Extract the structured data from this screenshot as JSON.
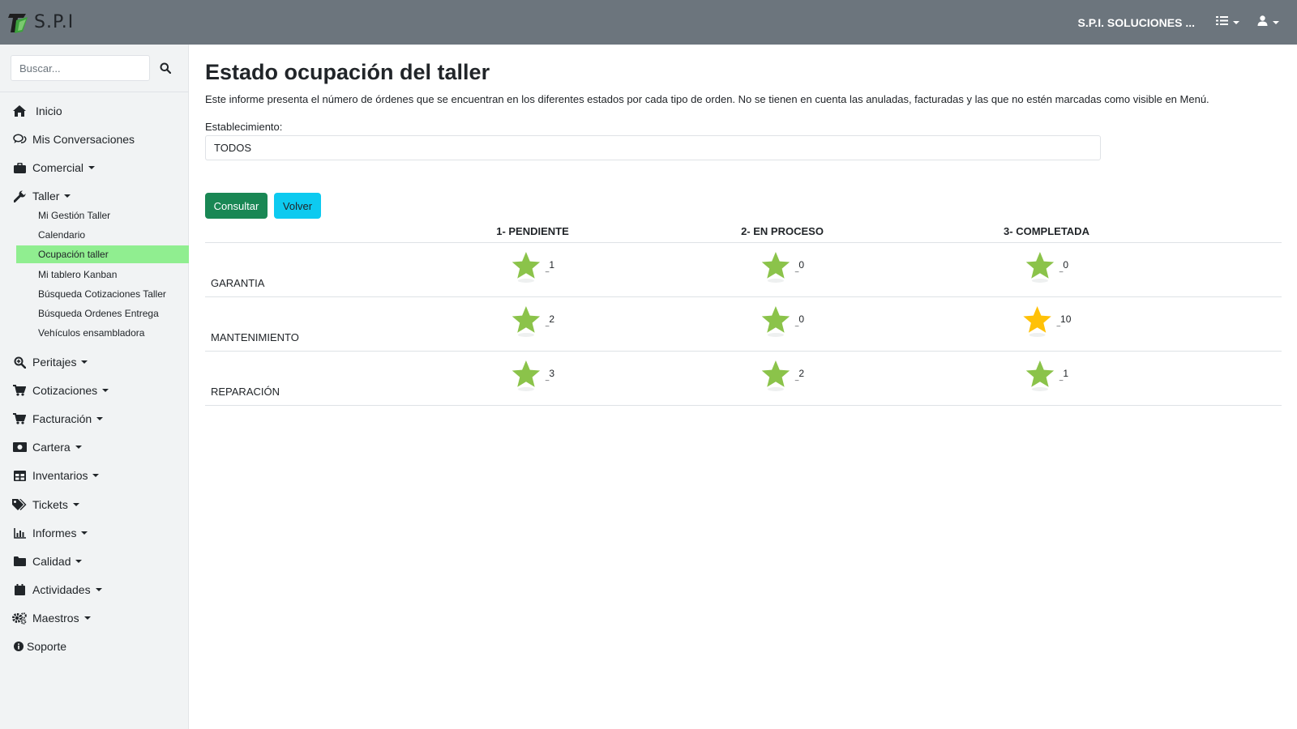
{
  "brand": {
    "name": "S.P.I"
  },
  "header": {
    "company": "S.P.I. SOLUCIONES ..."
  },
  "search": {
    "placeholder": "Buscar..."
  },
  "sidebar": {
    "items": [
      {
        "label": "Inicio"
      },
      {
        "label": "Mis Conversaciones"
      },
      {
        "label": "Comercial"
      },
      {
        "label": "Taller"
      },
      {
        "label": "Peritajes"
      },
      {
        "label": "Cotizaciones"
      },
      {
        "label": "Facturación"
      },
      {
        "label": "Cartera"
      },
      {
        "label": "Inventarios"
      },
      {
        "label": "Tickets"
      },
      {
        "label": "Informes"
      },
      {
        "label": "Calidad"
      },
      {
        "label": "Actividades"
      },
      {
        "label": "Maestros"
      },
      {
        "label": "Soporte"
      }
    ],
    "taller_sub": [
      {
        "label": "Mi Gestión Taller"
      },
      {
        "label": "Calendario"
      },
      {
        "label": "Ocupación taller",
        "active": true
      },
      {
        "label": "Mi tablero Kanban"
      },
      {
        "label": "Búsqueda Cotizaciones Taller"
      },
      {
        "label": "Búsqueda Ordenes Entrega"
      },
      {
        "label": "Vehículos ensambladora"
      }
    ]
  },
  "main": {
    "title": "Estado ocupación del taller",
    "description": "Este informe presenta el número de órdenes que se encuentran en los diferentes estados por cada tipo de orden. No se tienen en cuenta las anuladas, facturadas y las que no estén marcadas como visible en Menú.",
    "establecimiento_label": "Establecimiento:",
    "establecimiento_value": "TODOS",
    "consultar_label": "Consultar",
    "volver_label": "Volver"
  },
  "table": {
    "columns": [
      "1- PENDIENTE",
      "2- EN PROCESO",
      "3- COMPLETADA"
    ],
    "rows": [
      {
        "label": "GARANTIA",
        "values": [
          "1",
          "0",
          "0"
        ],
        "highlight": [
          false,
          false,
          false
        ]
      },
      {
        "label": "MANTENIMIENTO",
        "values": [
          "2",
          "0",
          "10"
        ],
        "highlight": [
          false,
          false,
          true
        ]
      },
      {
        "label": "REPARACIÓN",
        "values": [
          "3",
          "2",
          "1"
        ],
        "highlight": [
          false,
          false,
          false
        ]
      }
    ]
  },
  "colors": {
    "topbar": "#6c757d",
    "sidebar_bg": "#f1f3f4",
    "active_item": "#90ee90",
    "consultar": "#198754",
    "volver": "#0dcaf0",
    "star_green": "#8bc34a",
    "star_yellow": "#ffc107"
  }
}
